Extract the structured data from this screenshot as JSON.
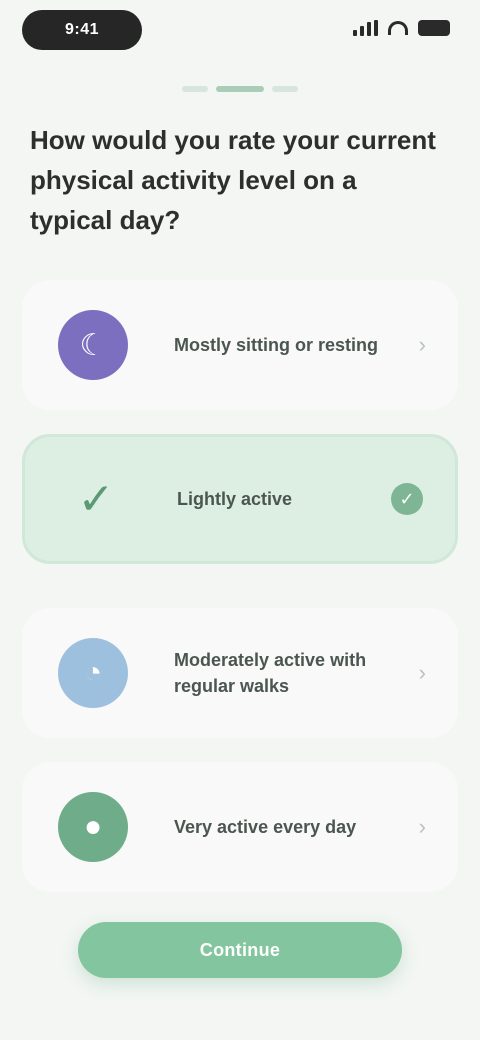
{
  "status_bar": {
    "time": "9:41"
  },
  "progress": {
    "total_steps": 3,
    "current_step": 2
  },
  "question": "How would you rate your current physical activity level on a typical day?",
  "options": [
    {
      "label": "Mostly sitting or resting",
      "icon": "couch-icon",
      "icon_glyph": "☾",
      "selected": false
    },
    {
      "label": "Lightly active",
      "icon": "check-icon",
      "icon_glyph": "✓",
      "selected": true
    },
    {
      "label": "Moderately active with regular walks",
      "icon": "walk-icon",
      "icon_glyph": "◔",
      "selected": false
    },
    {
      "label": "Very active every day",
      "icon": "run-icon",
      "icon_glyph": "●",
      "selected": false
    }
  ],
  "continue_label": "Continue",
  "colors": {
    "accent": "#82c59e",
    "selected_bg": "#dcefe2",
    "purple": "#7d6fbf",
    "blue": "#9cc0de",
    "green": "#6fac8a"
  }
}
